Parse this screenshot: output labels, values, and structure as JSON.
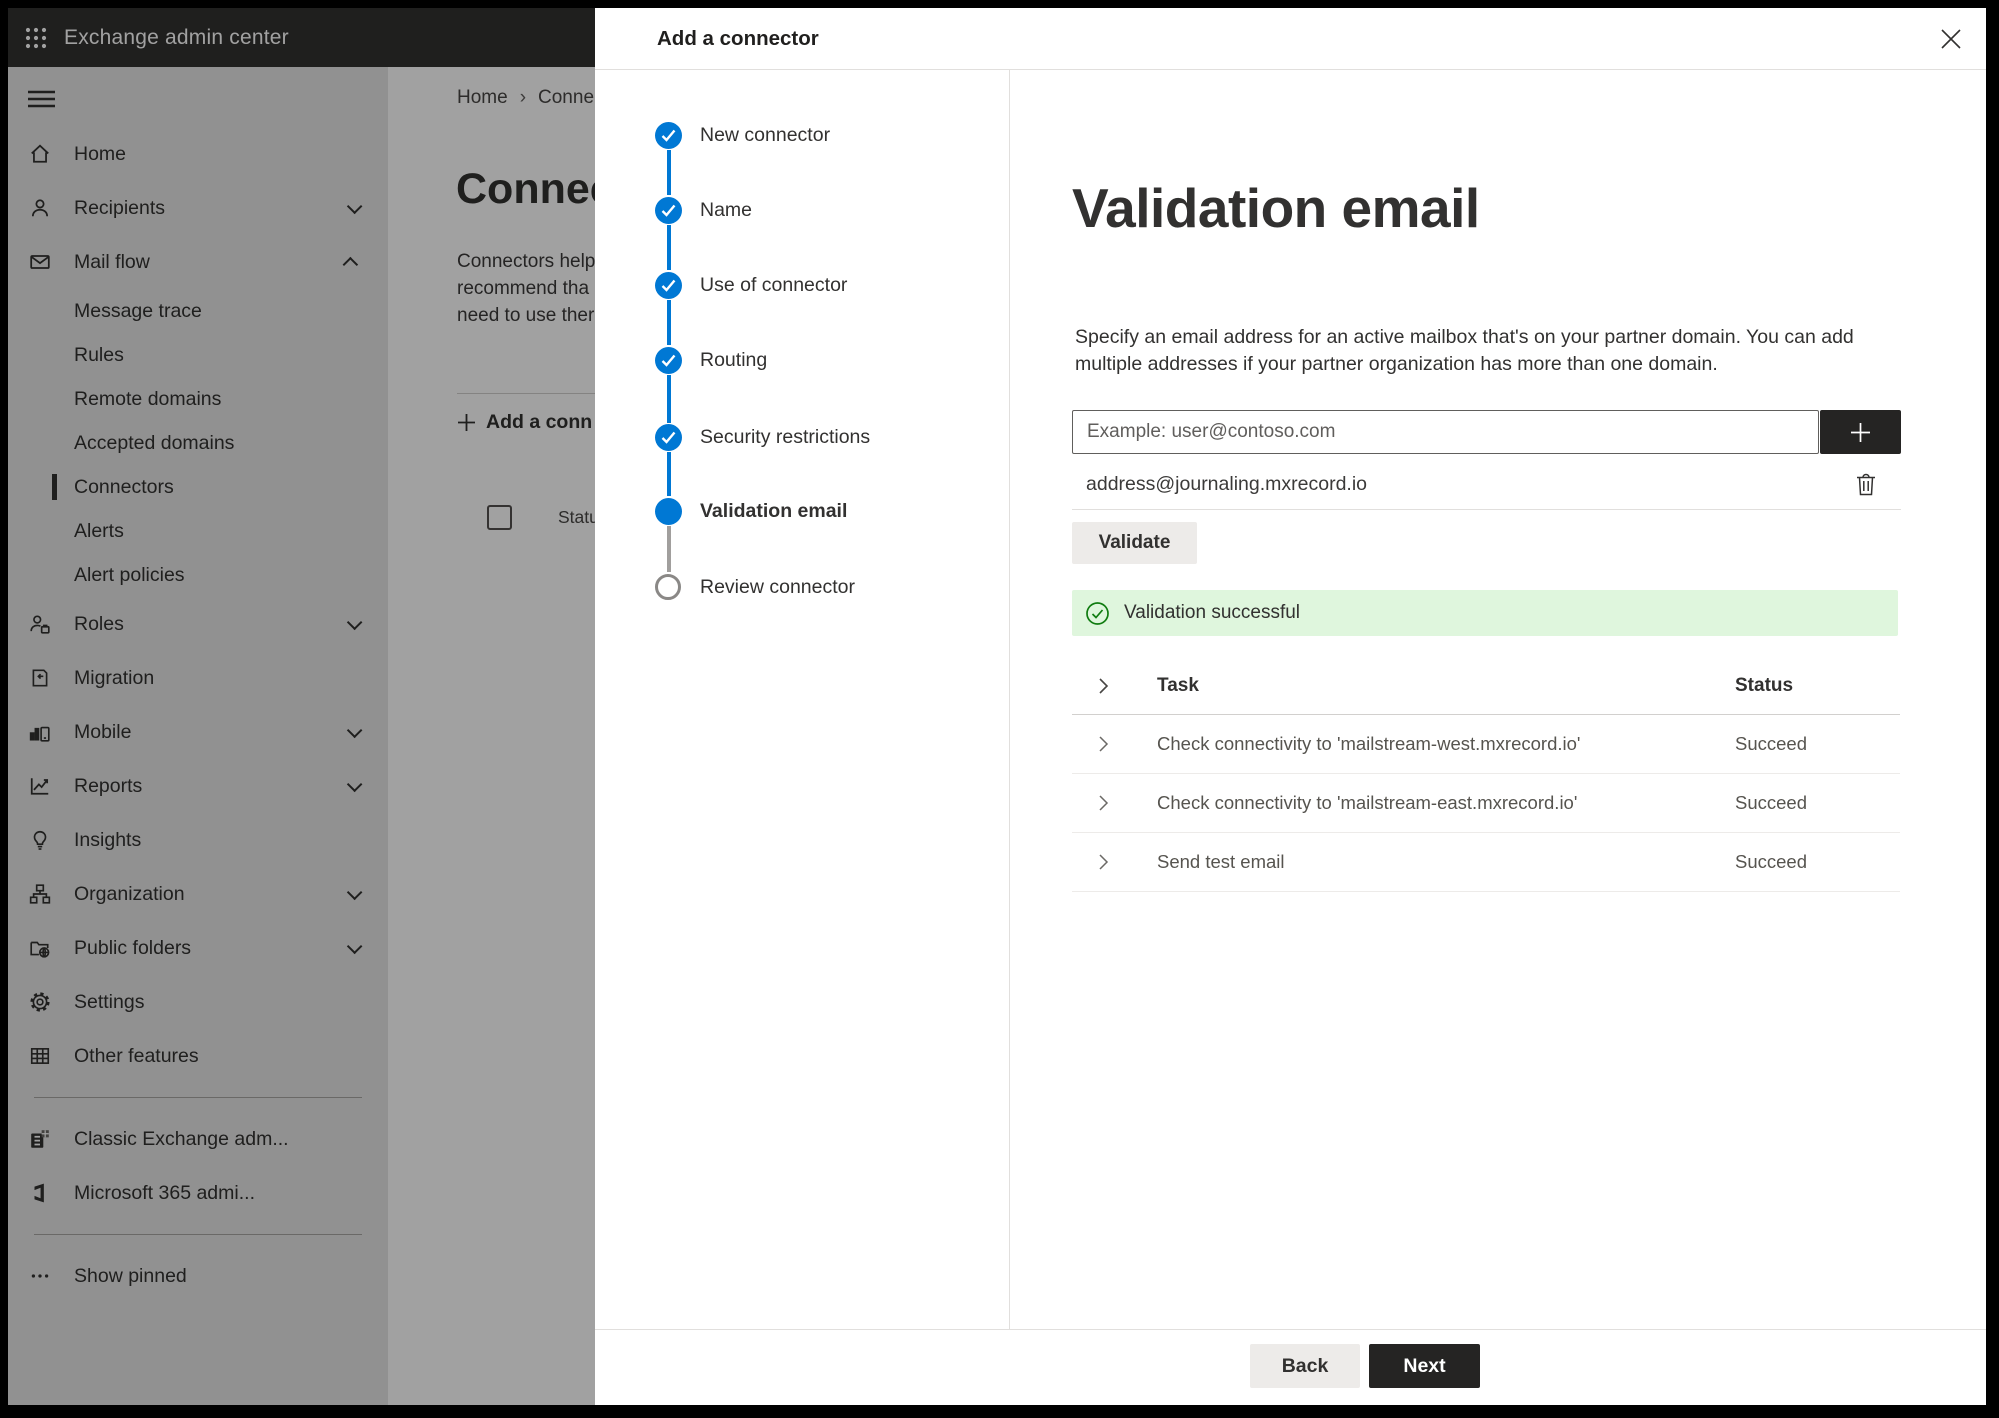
{
  "colors": {
    "accent_blue": "#0078d4",
    "success_green": "#107c10",
    "banner_green_bg": "#dff6dd",
    "dark_button": "#252423",
    "app_header_bg": "#323130"
  },
  "app_header": {
    "title": "Exchange admin center"
  },
  "sidebar": {
    "items": [
      {
        "label": "Home",
        "icon": "home-icon"
      },
      {
        "label": "Recipients",
        "icon": "person-icon",
        "chevron": "down"
      },
      {
        "label": "Mail flow",
        "icon": "envelope-icon",
        "chevron": "up",
        "expanded": true
      },
      {
        "label": "Message trace"
      },
      {
        "label": "Rules"
      },
      {
        "label": "Remote domains"
      },
      {
        "label": "Accepted domains"
      },
      {
        "label": "Connectors",
        "selected": true
      },
      {
        "label": "Alerts"
      },
      {
        "label": "Alert policies"
      },
      {
        "label": "Roles",
        "icon": "roles-icon",
        "chevron": "down"
      },
      {
        "label": "Migration",
        "icon": "migration-icon"
      },
      {
        "label": "Mobile",
        "icon": "mobile-icon",
        "chevron": "down"
      },
      {
        "label": "Reports",
        "icon": "reports-icon",
        "chevron": "down"
      },
      {
        "label": "Insights",
        "icon": "lightbulb-icon"
      },
      {
        "label": "Organization",
        "icon": "org-chart-icon",
        "chevron": "down"
      },
      {
        "label": "Public folders",
        "icon": "folder-globe-icon",
        "chevron": "down"
      },
      {
        "label": "Settings",
        "icon": "gear-icon"
      },
      {
        "label": "Other features",
        "icon": "grid-icon"
      },
      {
        "label": "Classic Exchange adm...",
        "icon": "exchange-logo-icon"
      },
      {
        "label": "Microsoft 365 admi...",
        "icon": "m365-logo-icon"
      },
      {
        "label": "Show pinned",
        "icon": "ellipsis-icon"
      }
    ]
  },
  "background_page": {
    "breadcrumb": {
      "home": "Home",
      "separator": "›",
      "current": "Conne"
    },
    "title": "Connec",
    "intro_lines": [
      "Connectors help",
      "recommend tha",
      "need to use ther"
    ],
    "add_button": "Add a conn",
    "status_header": "Status"
  },
  "wizard": {
    "title": "Add a connector",
    "steps": [
      {
        "label": "New connector",
        "state": "completed"
      },
      {
        "label": "Name",
        "state": "completed"
      },
      {
        "label": "Use of connector",
        "state": "completed"
      },
      {
        "label": "Routing",
        "state": "completed"
      },
      {
        "label": "Security restrictions",
        "state": "completed"
      },
      {
        "label": "Validation email",
        "state": "current"
      },
      {
        "label": "Review connector",
        "state": "upcoming"
      }
    ]
  },
  "main": {
    "title": "Validation email",
    "description": "Specify an email address for an active mailbox that's on your partner domain. You can add multiple addresses if your partner organization has more than one domain.",
    "email_placeholder": "Example: user@contoso.com",
    "added_address": "address@journaling.mxrecord.io",
    "validate_button": "Validate",
    "banner_text": "Validation successful",
    "table": {
      "columns": [
        "Task",
        "Status"
      ],
      "rows": [
        {
          "task": "Check connectivity to 'mailstream-west.mxrecord.io'",
          "status": "Succeed"
        },
        {
          "task": "Check connectivity to 'mailstream-east.mxrecord.io'",
          "status": "Succeed"
        },
        {
          "task": "Send test email",
          "status": "Succeed"
        }
      ]
    }
  },
  "footer": {
    "back": "Back",
    "next": "Next"
  }
}
